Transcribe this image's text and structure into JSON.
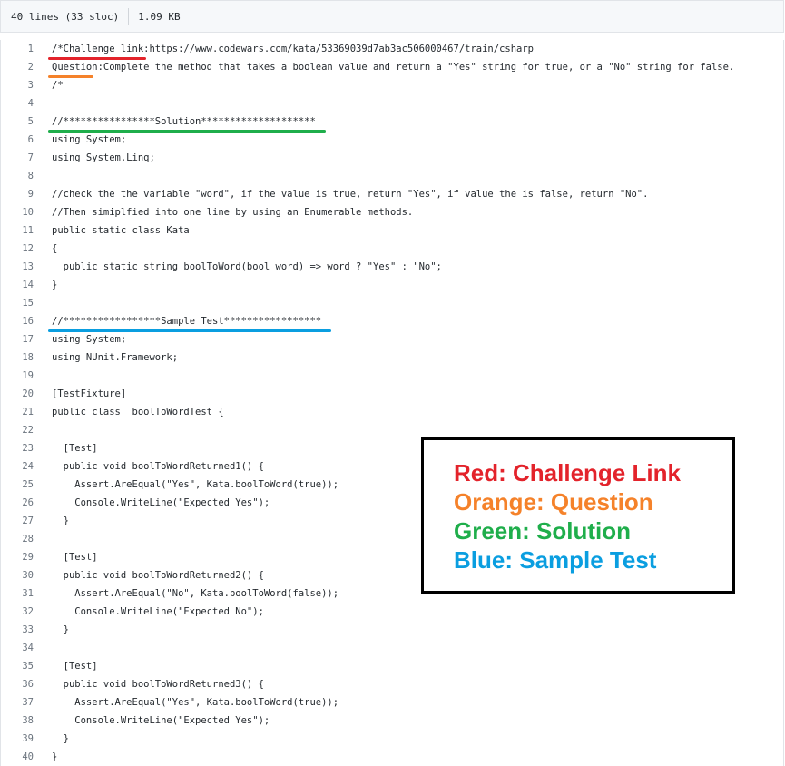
{
  "file_info": {
    "lines": "40 lines (33 sloc)",
    "size": "1.09 KB"
  },
  "code_lines": [
    "/*Challenge link:https://www.codewars.com/kata/53369039d7ab3ac506000467/train/csharp",
    "Question:Complete the method that takes a boolean value and return a \"Yes\" string for true, or a \"No\" string for false.",
    "/*",
    "",
    "//****************Solution********************",
    "using System;",
    "using System.Linq;",
    "",
    "//check the the variable \"word\", if the value is true, return \"Yes\", if value the is false, return \"No\".",
    "//Then simiplfied into one line by using an Enumerable methods.",
    "public static class Kata",
    "{",
    "  public static string boolToWord(bool word) => word ? \"Yes\" : \"No\";",
    "}",
    "",
    "//*****************Sample Test*****************",
    "using System;",
    "using NUnit.Framework;",
    "",
    "[TestFixture]",
    "public class  boolToWordTest {",
    "",
    "  [Test]",
    "  public void boolToWordReturned1() {",
    "    Assert.AreEqual(\"Yes\", Kata.boolToWord(true));",
    "    Console.WriteLine(\"Expected Yes\");",
    "  }",
    "",
    "  [Test]",
    "  public void boolToWordReturned2() {",
    "    Assert.AreEqual(\"No\", Kata.boolToWord(false));",
    "    Console.WriteLine(\"Expected No\");",
    "  }",
    "",
    "  [Test]",
    "  public void boolToWordReturned3() {",
    "    Assert.AreEqual(\"Yes\", Kata.boolToWord(true));",
    "    Console.WriteLine(\"Expected Yes\");",
    "  }",
    "}"
  ],
  "annotations": [
    {
      "label": "Red: Challenge Link",
      "color": "#e3232b",
      "line": 1
    },
    {
      "label": "Orange: Question",
      "color": "#f5822a",
      "line": 2
    },
    {
      "label": "Green: Solution",
      "color": "#1fae4b",
      "line": 5
    },
    {
      "label": "Blue: Sample Test",
      "color": "#0a9ee0",
      "line": 16
    }
  ]
}
